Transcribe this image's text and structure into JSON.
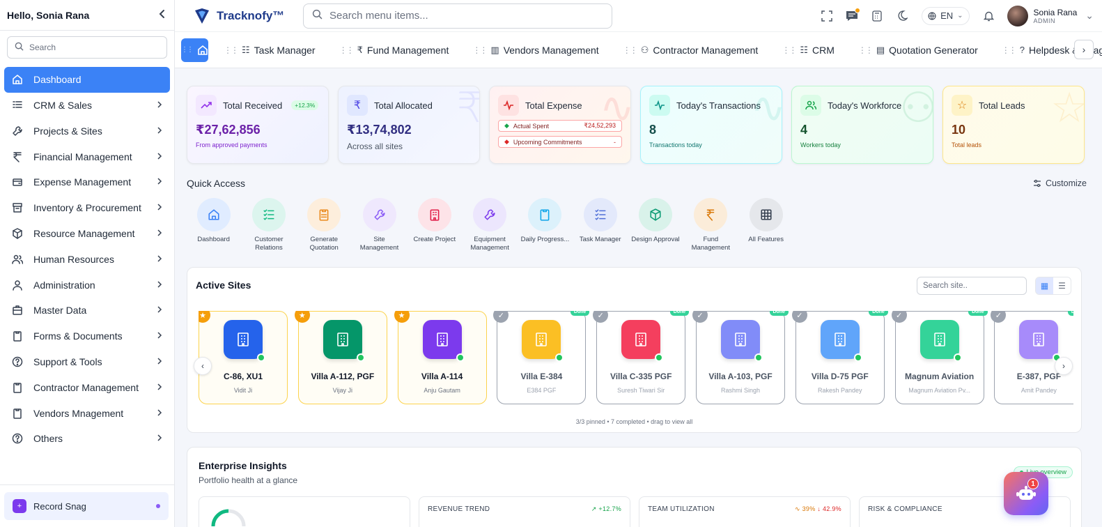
{
  "sidebar": {
    "greeting": "Hello, Sonia Rana",
    "search_placeholder": "Search",
    "items": [
      {
        "label": "Dashboard"
      },
      {
        "label": "CRM & Sales"
      },
      {
        "label": "Projects & Sites"
      },
      {
        "label": "Financial Management"
      },
      {
        "label": "Expense Management"
      },
      {
        "label": "Inventory & Procurement"
      },
      {
        "label": "Resource Management"
      },
      {
        "label": "Human Resources"
      },
      {
        "label": "Administration"
      },
      {
        "label": "Master Data"
      },
      {
        "label": "Forms & Documents"
      },
      {
        "label": "Support & Tools"
      },
      {
        "label": "Contractor Management"
      },
      {
        "label": "Vendors Mnagement"
      },
      {
        "label": "Others"
      }
    ],
    "record_snag": "Record Snag"
  },
  "topbar": {
    "brand": "Tracknofy™",
    "search_placeholder": "Search menu items...",
    "language": "EN",
    "user_name": "Sonia Rana",
    "user_role": "ADMIN"
  },
  "tabs": [
    "Task Manager",
    "Fund Management",
    "Vendors Management",
    "Contractor Management",
    "CRM",
    "Quotation Generator",
    "Helpdesk & Snag"
  ],
  "stats": {
    "received": {
      "title": "Total Received",
      "growth": "+12.3%",
      "value": "₹27,62,856",
      "sub": "From approved payments"
    },
    "allocated": {
      "title": "Total Allocated",
      "value": "₹13,74,802",
      "sub": "Across all sites"
    },
    "expense": {
      "title": "Total Expense",
      "actual_label": "Actual Spent",
      "actual_value": "₹24,52,293",
      "upcoming_label": "Upcoming Commitments",
      "upcoming_value": "-"
    },
    "transactions": {
      "title": "Today's Transactions",
      "value": "8",
      "sub": "Transactions today"
    },
    "workforce": {
      "title": "Today's Workforce",
      "value": "4",
      "sub": "Workers today"
    },
    "leads": {
      "title": "Total Leads",
      "value": "10",
      "sub": "Total leads"
    }
  },
  "quick_access": {
    "title": "Quick Access",
    "customize": "Customize",
    "items": [
      {
        "label": "Dashboard",
        "color": "#3b82f6",
        "bg": "#e0ecff"
      },
      {
        "label": "Customer Relations",
        "color": "#10b981",
        "bg": "#dcf5ee"
      },
      {
        "label": "Generate Quotation",
        "color": "#ea8a1e",
        "bg": "#fdeedc"
      },
      {
        "label": "Site Management",
        "color": "#8b5cf6",
        "bg": "#efe8fd"
      },
      {
        "label": "Create Project",
        "color": "#e11d48",
        "bg": "#fde3e8"
      },
      {
        "label": "Equipment Management",
        "color": "#7c3aed",
        "bg": "#ece6fd"
      },
      {
        "label": "Daily Progress...",
        "color": "#0ea5e9",
        "bg": "#dcf1fb"
      },
      {
        "label": "Task Manager",
        "color": "#4f6fd8",
        "bg": "#e3e9fb"
      },
      {
        "label": "Design Approval",
        "color": "#0f9d76",
        "bg": "#d9f2ea"
      },
      {
        "label": "Fund Management",
        "color": "#d97706",
        "bg": "#fbecd9"
      },
      {
        "label": "All Features",
        "color": "#374151",
        "bg": "#e5e7eb"
      }
    ]
  },
  "active_sites": {
    "title": "Active Sites",
    "search_placeholder": "Search site..",
    "done_label": "Done",
    "footer": "3/3 pinned • 7 completed • drag to view all",
    "sites": [
      {
        "name": "C-86, XU1",
        "person": "Vidit Ji",
        "pinned": true,
        "color": "#2563eb"
      },
      {
        "name": "Villa A-112, PGF",
        "person": "Vijay Ji",
        "pinned": true,
        "color": "#059669"
      },
      {
        "name": "Villa A-114",
        "person": "Anju Gautam",
        "pinned": true,
        "color": "#7c3aed"
      },
      {
        "name": "Villa E-384",
        "person": "E384 PGF",
        "pinned": false,
        "color": "#fbbf24"
      },
      {
        "name": "Villa C-335 PGF",
        "person": "Suresh Tiwari Sir",
        "pinned": false,
        "color": "#f43f5e"
      },
      {
        "name": "Villa A-103, PGF",
        "person": "Rashmi Singh",
        "pinned": false,
        "color": "#818cf8"
      },
      {
        "name": "Villa D-75 PGF",
        "person": "Rakesh Pandey",
        "pinned": false,
        "color": "#60a5fa"
      },
      {
        "name": "Magnum Aviation",
        "person": "Magnum Aviation Pv...",
        "pinned": false,
        "color": "#34d399"
      },
      {
        "name": "E-387, PGF",
        "person": "Amit Pandey",
        "pinned": false,
        "color": "#a78bfa"
      }
    ]
  },
  "insights": {
    "title": "Enterprise Insights",
    "subtitle": "Portfolio health at a glance",
    "live": "Live overview",
    "cards": [
      {
        "title": "",
        "right": ""
      },
      {
        "title": "REVENUE TREND",
        "right": "+12.7%"
      },
      {
        "title": "TEAM UTILIZATION",
        "right_a": "39%",
        "right_b": "42.9%"
      },
      {
        "title": "RISK & COMPLIANCE",
        "right": ""
      }
    ]
  },
  "assistant": {
    "count": "1"
  }
}
